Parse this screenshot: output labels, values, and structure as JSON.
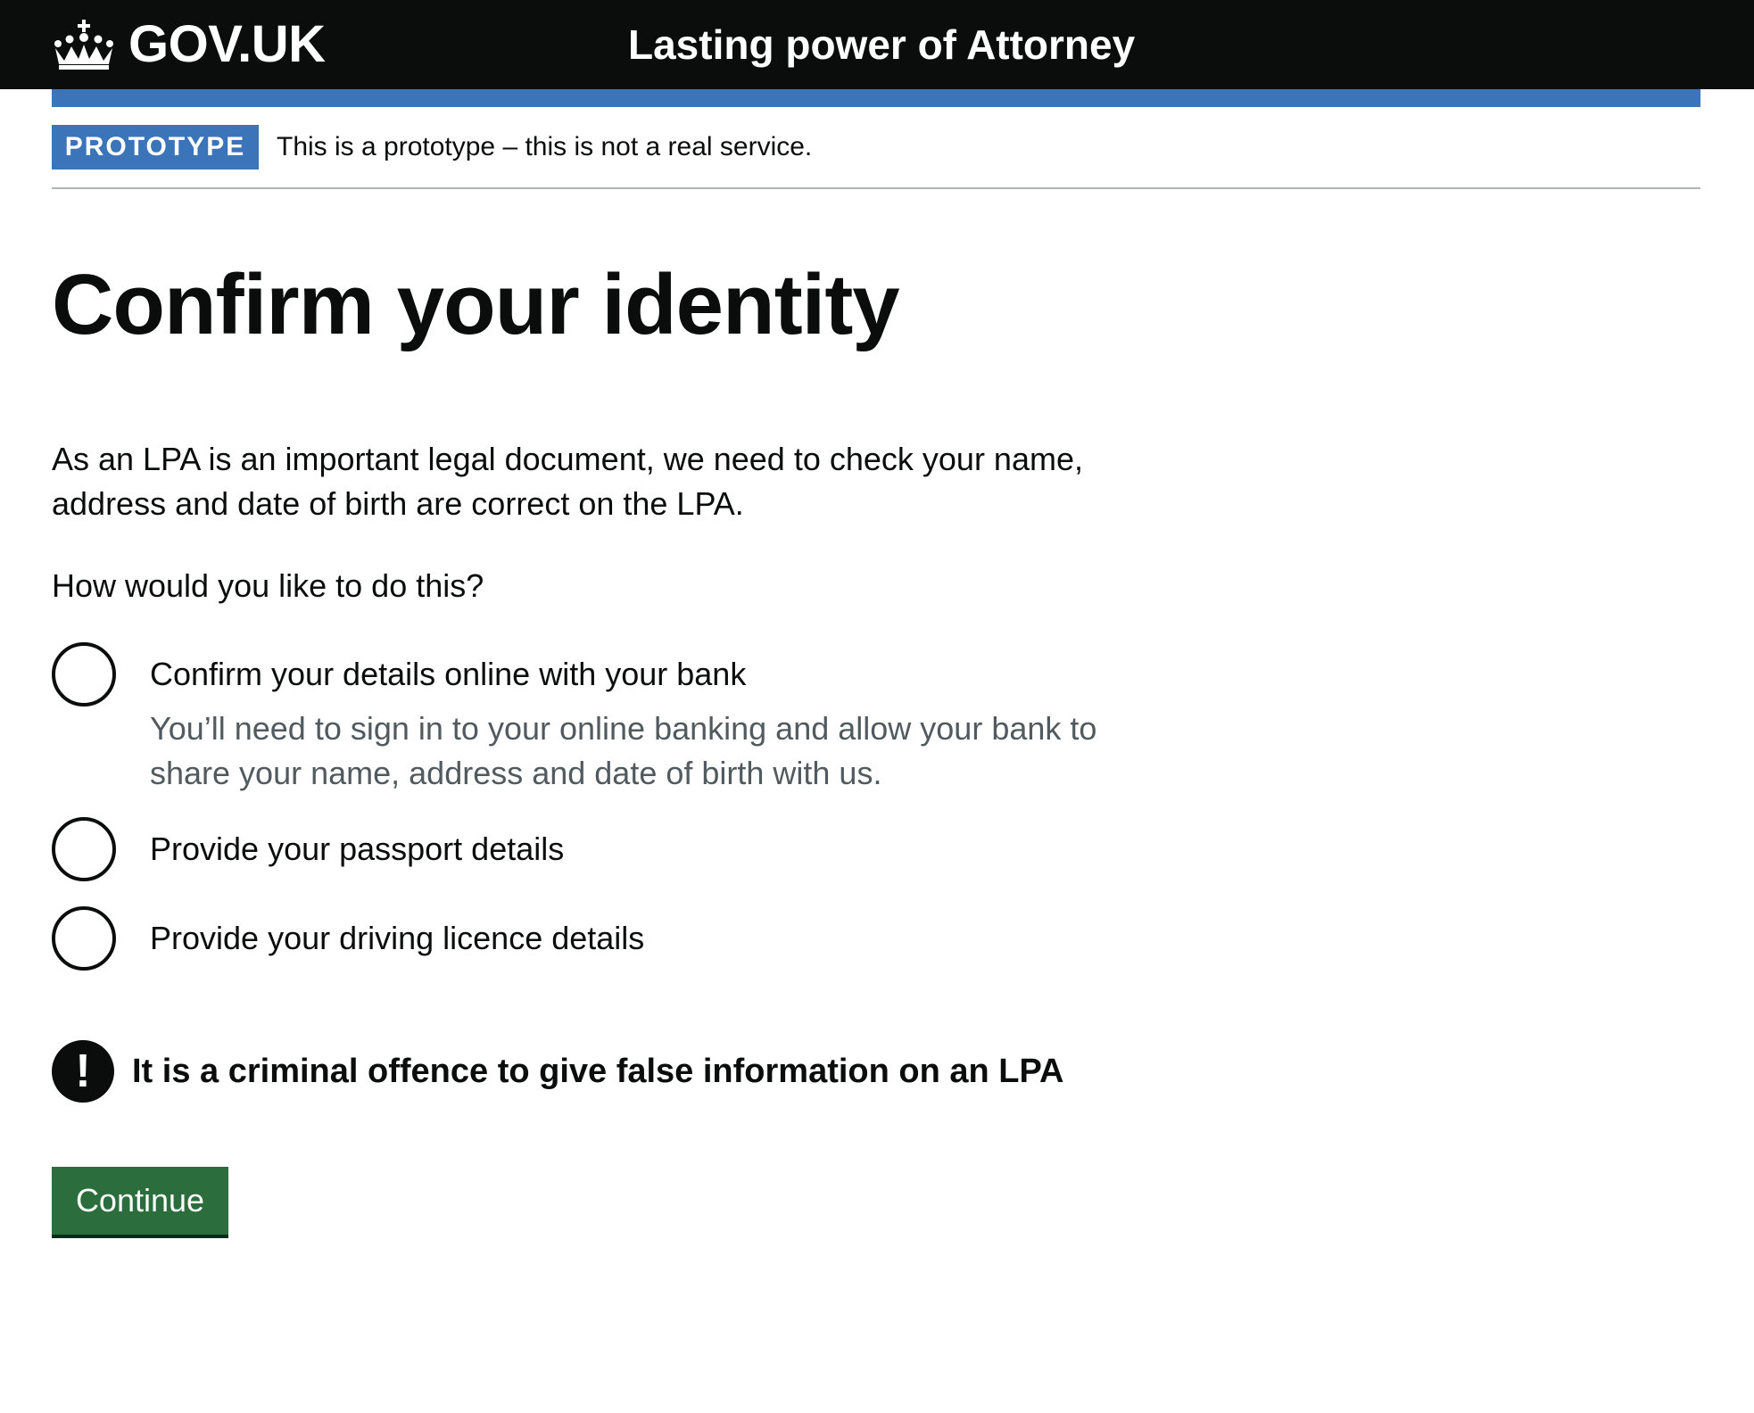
{
  "header": {
    "logo_text": "GOV.UK",
    "service_name": "Lasting power of Attorney",
    "crown_icon": "crown-icon"
  },
  "phase_banner": {
    "tag": "PROTOTYPE",
    "text": "This is a prototype – this is not a real service."
  },
  "main": {
    "title": "Confirm your identity",
    "intro": "As an LPA is an important legal document, we need to check your name, address and date of birth are correct on the LPA.",
    "question": "How would you like to do this?",
    "options": [
      {
        "label": "Confirm your details online with your bank",
        "hint": "You’ll need to sign in to your online banking and allow your bank to share your name, address and date of birth with us.",
        "selected": false
      },
      {
        "label": "Provide your passport details",
        "selected": false
      },
      {
        "label": "Provide your driving licence details",
        "selected": false
      }
    ],
    "warning": {
      "icon": "!",
      "text": "It is a criminal offence to give false information on an LPA"
    },
    "continue_label": "Continue"
  },
  "colors": {
    "header_bg": "#0b0c0c",
    "brand_blue": "#3b74b9",
    "button_green": "#2b6d3c",
    "hint_grey": "#505a5f"
  }
}
